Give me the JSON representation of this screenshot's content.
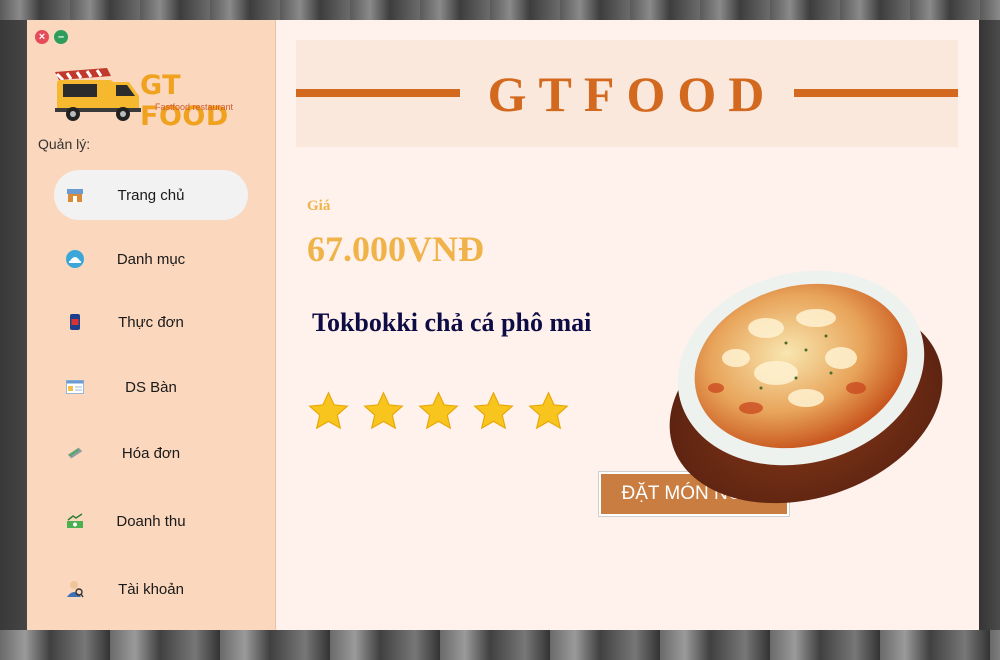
{
  "window_controls": {
    "close_glyph": "×",
    "minimize_glyph": "–"
  },
  "logo": {
    "name": "GT FOOD",
    "tagline": "Fastfood restaurant"
  },
  "sidebar": {
    "section_label": "Quản lý:",
    "items": [
      {
        "label": "Trang chủ",
        "icon": "home-icon",
        "active": true
      },
      {
        "label": "Danh mục",
        "icon": "category-icon",
        "active": false
      },
      {
        "label": "Thực đơn",
        "icon": "menu-icon",
        "active": false
      },
      {
        "label": "DS Bàn",
        "icon": "table-list-icon",
        "active": false
      },
      {
        "label": "Hóa đơn",
        "icon": "invoice-icon",
        "active": false
      },
      {
        "label": "Doanh thu",
        "icon": "revenue-icon",
        "active": false
      },
      {
        "label": "Tài khoản",
        "icon": "account-icon",
        "active": false
      }
    ]
  },
  "banner": {
    "title": "GTFOOD"
  },
  "product": {
    "price_label": "Giá",
    "price": "67.000VNĐ",
    "name": "Tokbokki chả cá phô mai",
    "rating": 5,
    "rating_max": 5
  },
  "order_button": {
    "label": "ĐẶT MÓN NGAY"
  },
  "colors": {
    "sidebar_bg": "#fad7bd",
    "main_bg": "#fff1ec",
    "accent": "#d2691e",
    "price": "#f0b34a",
    "dish_name": "#0e0c45",
    "button": "#c97d40",
    "star": "#f7c51e"
  }
}
